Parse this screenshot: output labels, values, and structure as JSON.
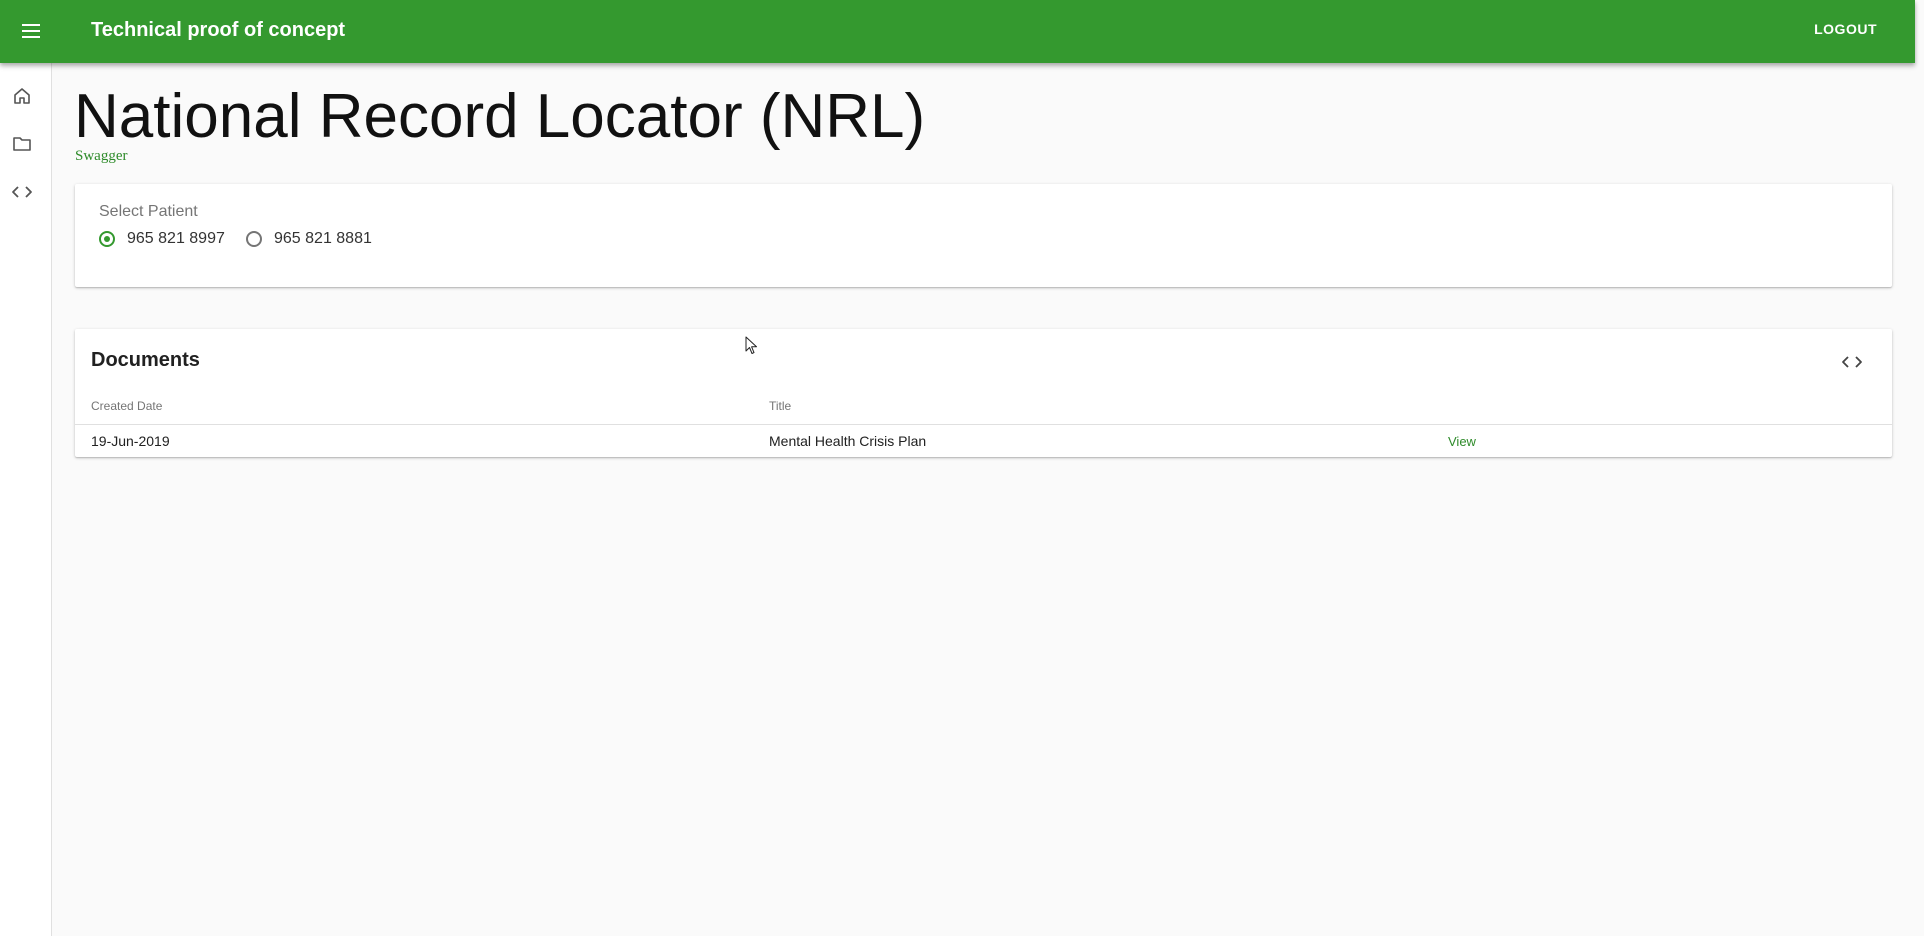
{
  "app": {
    "title": "Technical proof of concept",
    "logout_label": "LOGOUT",
    "accent_color": "#34992f"
  },
  "nav": {
    "items": [
      {
        "icon": "home-icon"
      },
      {
        "icon": "folder-icon"
      },
      {
        "icon": "code-icon"
      }
    ]
  },
  "page": {
    "title": "National Record Locator (NRL)",
    "swagger_label": "Swagger"
  },
  "patient_select": {
    "label": "Select Patient",
    "options": [
      {
        "label": "965 821 8997",
        "selected": true
      },
      {
        "label": "965 821 8881",
        "selected": false
      }
    ]
  },
  "documents": {
    "title": "Documents",
    "columns": [
      "Created Date",
      "Title"
    ],
    "rows": [
      {
        "created": "19-Jun-2019",
        "title": "Mental Health Crisis Plan",
        "action": "View"
      }
    ]
  }
}
